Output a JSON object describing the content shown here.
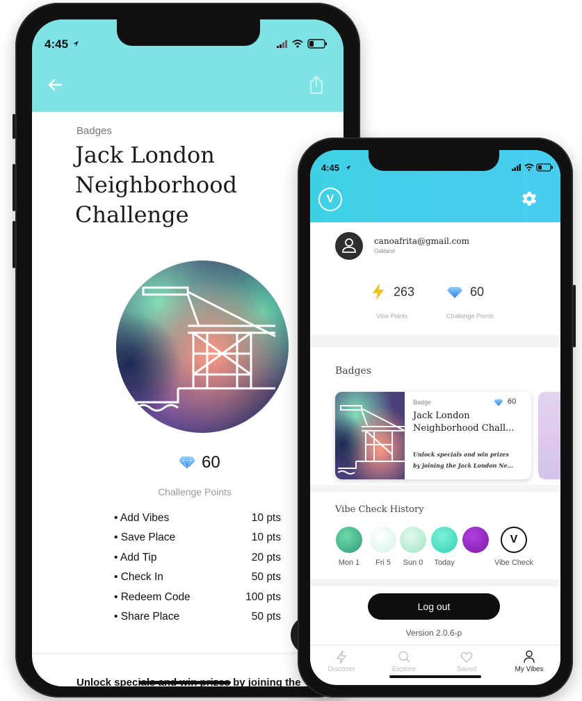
{
  "left_phone": {
    "time": "4:45",
    "section_label": "Badges",
    "title_lines": [
      "Jack London",
      "Neighborhood",
      "Challenge"
    ],
    "points": "60",
    "points_label": "Challenge Points",
    "actions": [
      {
        "label": "Add Vibes",
        "pts": "10 pts"
      },
      {
        "label": "Save Place",
        "pts": "10 pts"
      },
      {
        "label": "Add Tip",
        "pts": "20 pts"
      },
      {
        "label": "Check In",
        "pts": "50 pts"
      },
      {
        "label": "Redeem Code",
        "pts": "100 pts"
      },
      {
        "label": "Share Place",
        "pts": "50 pts"
      }
    ],
    "bottom_text": "Unlock specials and win prizes by joining the",
    "fab_label": "+"
  },
  "right_phone": {
    "time": "4:45",
    "logo_letter": "V",
    "email": "canoafrita@gmail.com",
    "location": "Oakland",
    "vibe_points": "263",
    "vibe_points_label": "Vibe Points",
    "challenge_points": "60",
    "challenge_points_label": "Challenge Points",
    "badges_heading": "Badges",
    "badge_card": {
      "kicker": "Badge",
      "points": "60",
      "title_line1": "Jack London",
      "title_line2": "Neighborhood Chall...",
      "desc_line1": "Unlock specials and win prizes",
      "desc_line2": "by joining the Jack London Ne..."
    },
    "history_heading": "Vibe Check History",
    "history": [
      {
        "label": "Mon 1",
        "color": "#2f9e7a"
      },
      {
        "label": "Fri 5",
        "color": "#e3f7ef"
      },
      {
        "label": "Sun 0",
        "color": "#b6ecd0"
      },
      {
        "label": "Today",
        "color": "#4fe0c3"
      },
      {
        "label": "",
        "color": "#8e24b8"
      }
    ],
    "vibe_check_label": "Vibe Check",
    "logout_label": "Log out",
    "version": "Version 2.0.6-p",
    "tabs": [
      {
        "label": "Discover",
        "icon": "lightning-icon",
        "active": false
      },
      {
        "label": "Explore",
        "icon": "search-icon",
        "active": false
      },
      {
        "label": "Saved",
        "icon": "heart-icon",
        "active": false
      },
      {
        "label": "My Vibes",
        "icon": "person-icon",
        "active": true
      }
    ]
  },
  "colors": {
    "left_header": "#7fe2e4",
    "right_header": "#45cfea",
    "diamond": "#3a95e8",
    "bolt": "#f2c21b"
  }
}
